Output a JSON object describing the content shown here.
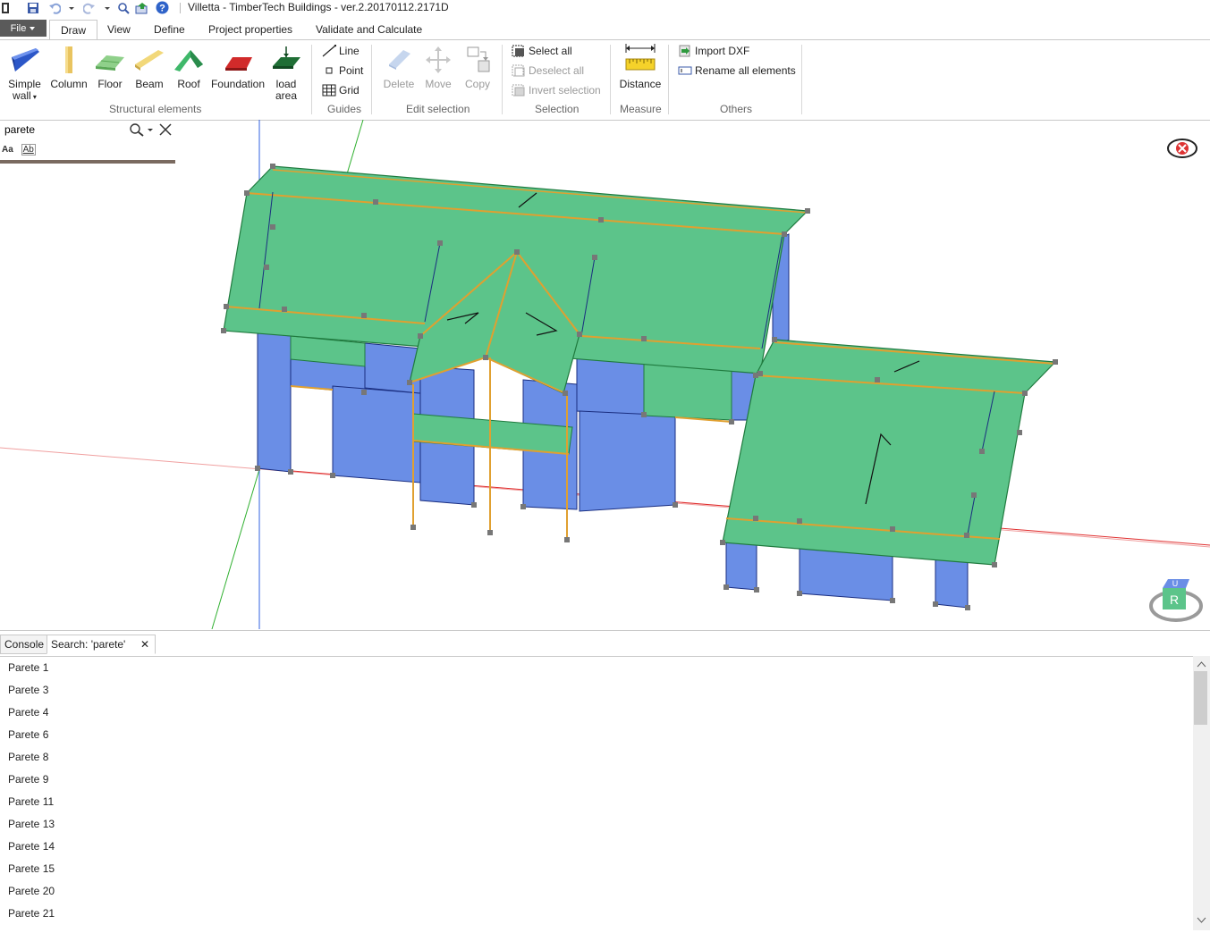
{
  "window": {
    "title": "Villetta - TimberTech Buildings - ver.2.20170112.2171D"
  },
  "menu": {
    "file_label": "File",
    "tabs": [
      "Draw",
      "View",
      "Define",
      "Project properties",
      "Validate and Calculate"
    ]
  },
  "ribbon": {
    "structural": {
      "simple_wall_line1": "Simple",
      "simple_wall_line2": "wall",
      "column": "Column",
      "floor": "Floor",
      "beam": "Beam",
      "roof": "Roof",
      "foundation": "Foundation",
      "load_area_line1": "load",
      "load_area_line2": "area",
      "group_label": "Structural elements"
    },
    "guides": {
      "line": "Line",
      "point": "Point",
      "grid": "Grid",
      "group_label": "Guides"
    },
    "edit_selection": {
      "delete": "Delete",
      "move": "Move",
      "copy": "Copy",
      "group_label": "Edit selection"
    },
    "selection": {
      "select_all": "Select all",
      "deselect_all": "Deselect all",
      "invert_selection": "Invert selection",
      "group_label": "Selection"
    },
    "measure": {
      "distance": "Distance",
      "group_label": "Measure"
    },
    "others": {
      "import_dxf": "Import DXF",
      "rename_all": "Rename all elements",
      "group_label": "Others"
    }
  },
  "search": {
    "value": "parete",
    "match_case": "Aa",
    "whole_word": "Ab"
  },
  "viewcube": {
    "top": "U",
    "front": "R"
  },
  "bottom_panel": {
    "tabs": [
      "Console",
      "Search: 'parete'"
    ],
    "results": [
      "Parete 1",
      "Parete 3",
      "Parete 4",
      "Parete 6",
      "Parete 8",
      "Parete 9",
      "Parete 11",
      "Parete 13",
      "Parete 14",
      "Parete 15",
      "Parete 20",
      "Parete 21"
    ]
  },
  "colors": {
    "wall": "#6a8ee6",
    "roof": "#5cc48a",
    "beam": "#e0a030",
    "x_axis": "#e03030",
    "y_axis": "#30b030",
    "z_axis": "#3060e0"
  }
}
